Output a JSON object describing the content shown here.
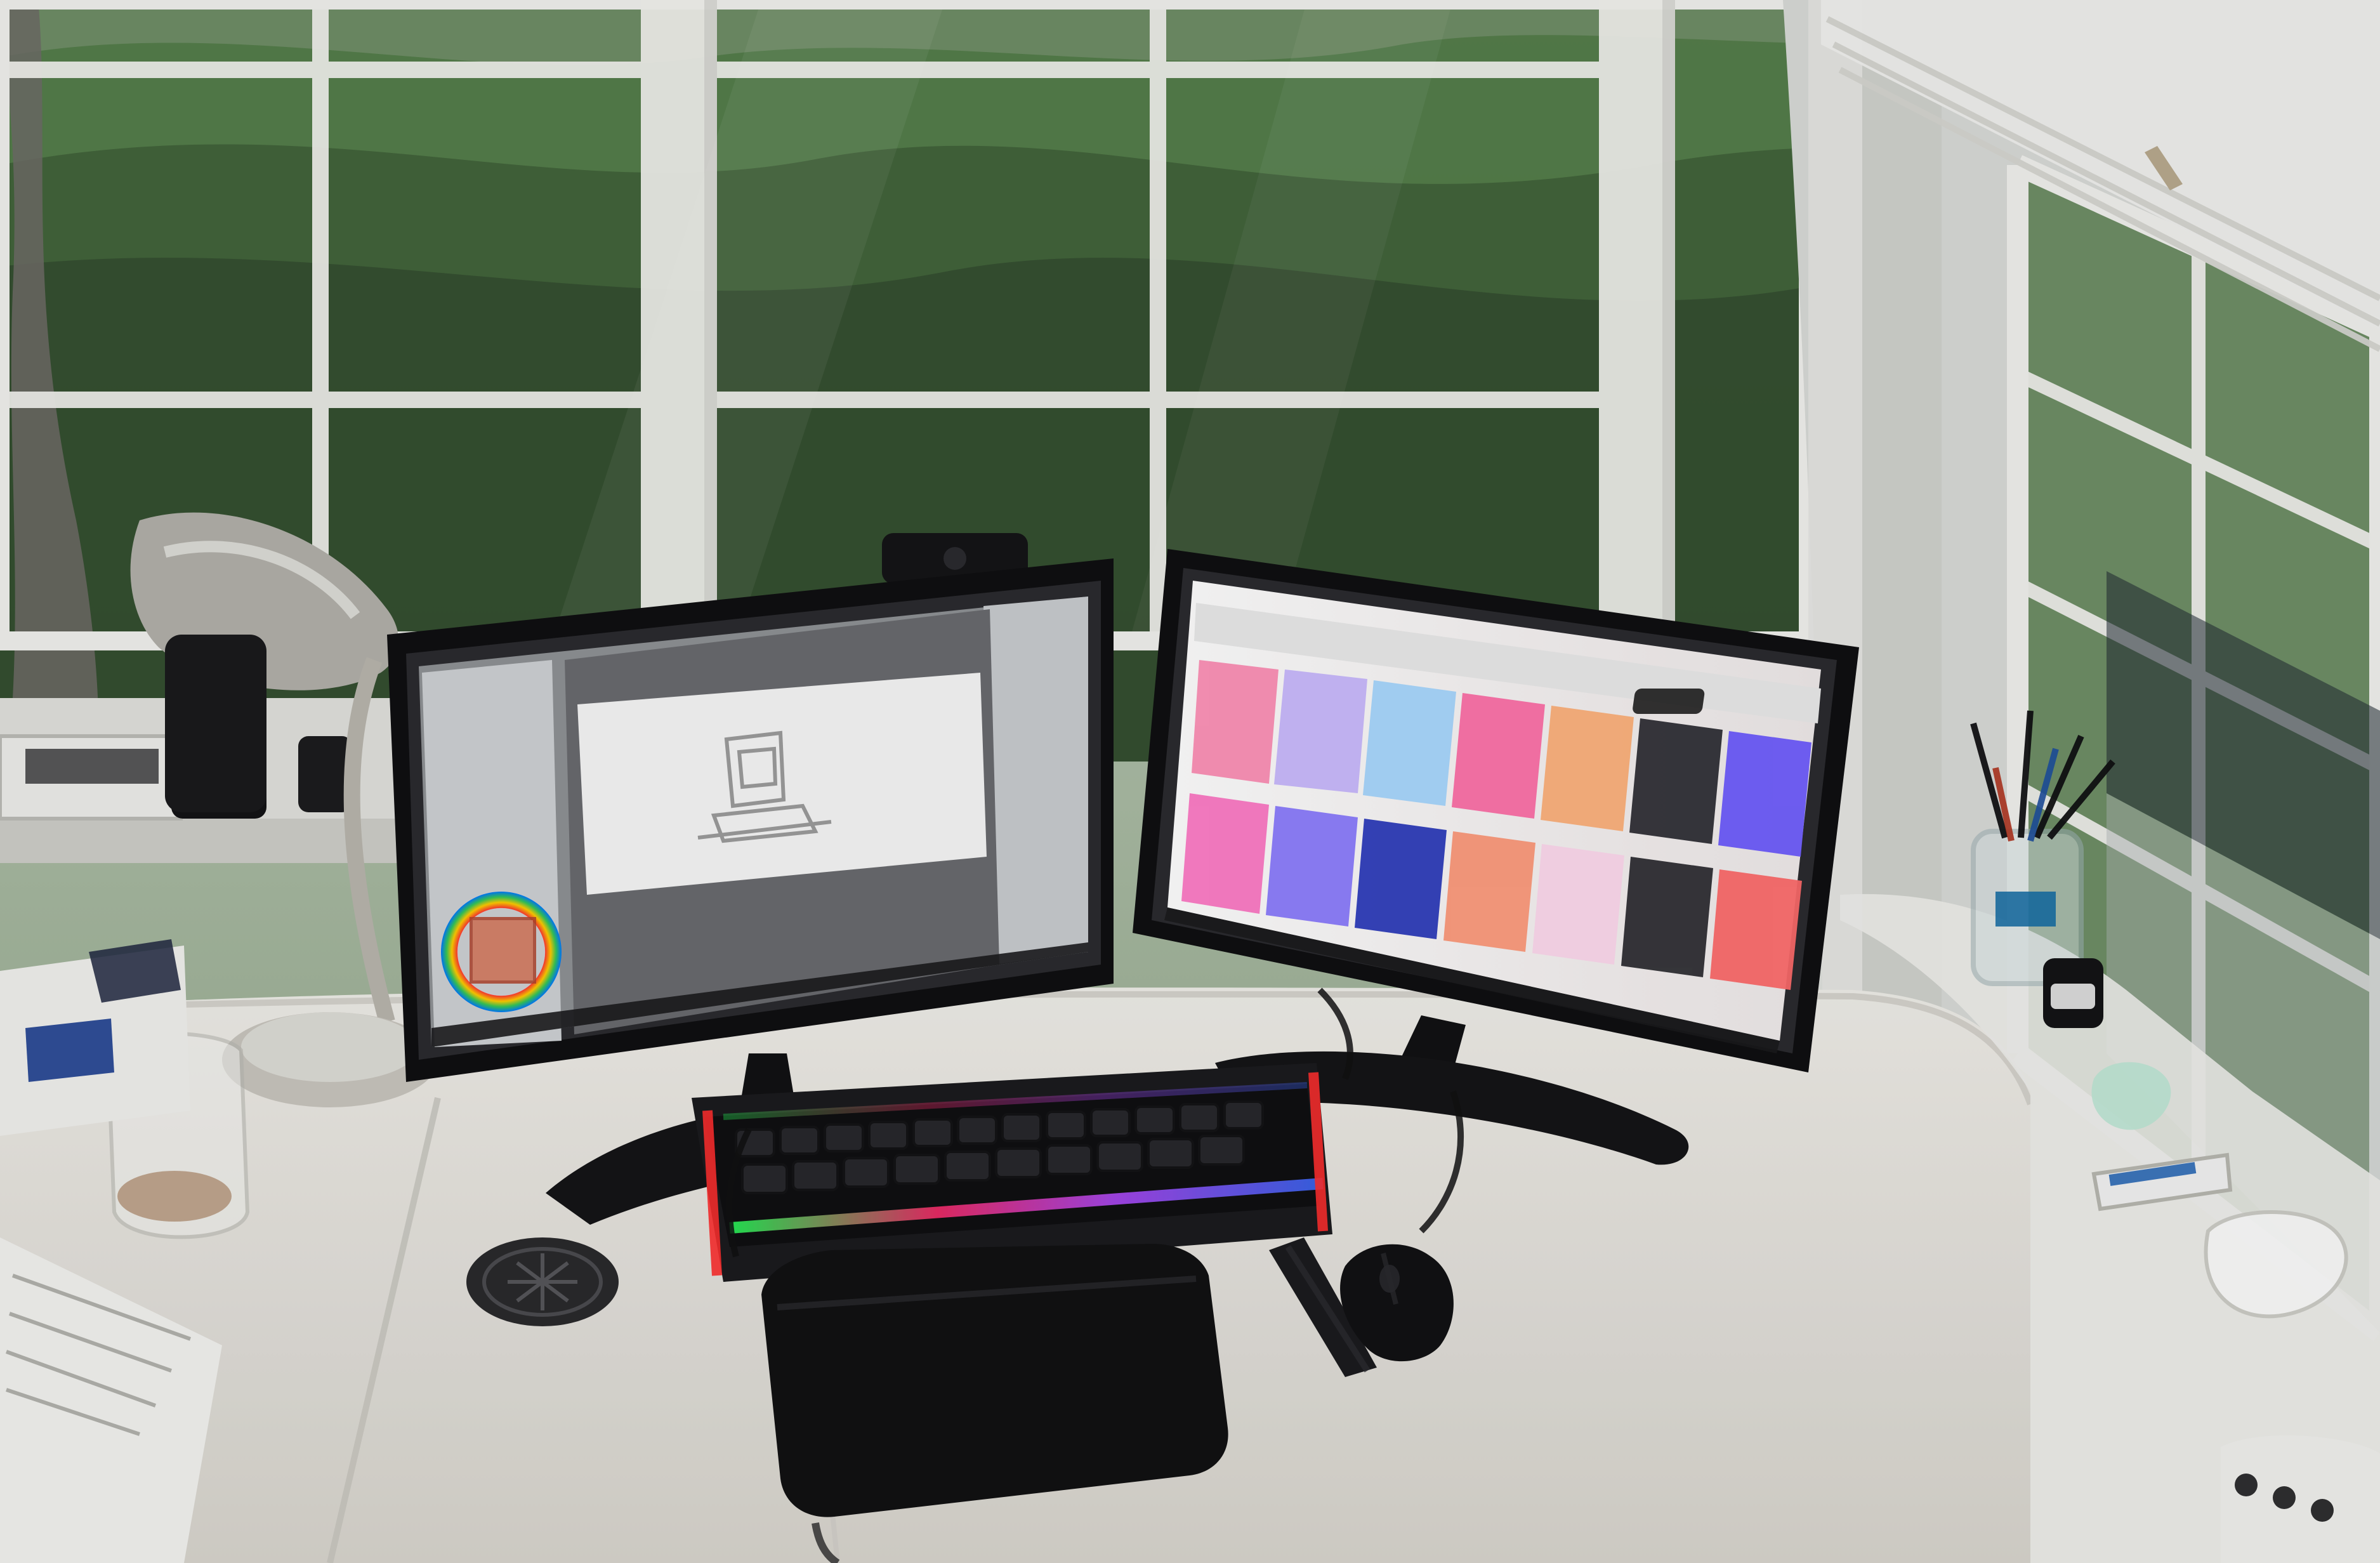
{
  "scene": {
    "kind": "photo",
    "subject": "home-office-desk"
  },
  "palette": {
    "foliage_dark": "#2f4a2a",
    "foliage_mid": "#4f7a45",
    "foliage_light": "#8db37a",
    "window_frame": "#f2f2ee",
    "wall": "#d9dbd8",
    "desk": "#e9e7e2",
    "monitor_bezel": "#121214",
    "screen_left_bg": "#6f6f72",
    "screen_right_bg": "#f6f1f2",
    "keyboard": "#1b1b1e",
    "rgb_1": "#26ff5a",
    "rgb_2": "#ff2e6e",
    "rgb_3": "#b34bff",
    "rgb_4": "#3c6bff"
  },
  "icons": {
    "lamp": "desk-lamp-icon",
    "webcam": "webcam-icon",
    "mouse": "mouse-icon",
    "stylus": "stylus-icon",
    "color_wheel": "color-wheel-icon"
  }
}
